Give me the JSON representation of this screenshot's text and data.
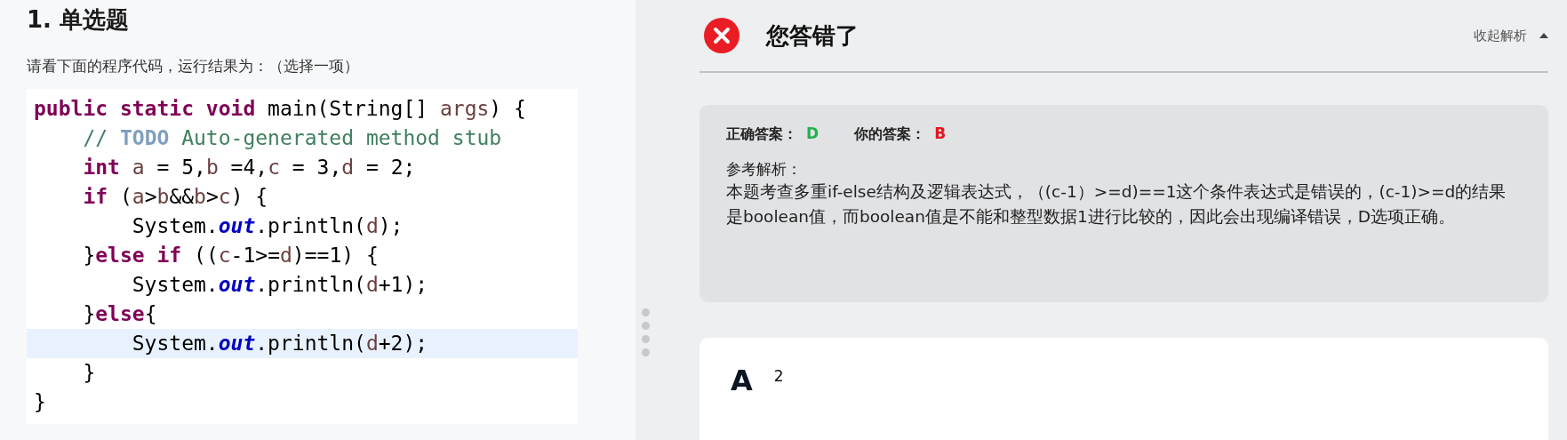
{
  "question": {
    "heading": "1. 单选题",
    "prompt": "请看下面的程序代码，运行结果为：（选择一项）",
    "code": [
      {
        "current": false,
        "tokens": [
          {
            "kind": "keyword",
            "text": "public static void"
          },
          {
            "kind": "plain",
            "text": " main(String[] "
          },
          {
            "kind": "var",
            "text": "args"
          },
          {
            "kind": "plain",
            "text": ") {"
          }
        ]
      },
      {
        "current": false,
        "tokens": [
          {
            "kind": "comment",
            "text": "    // "
          },
          {
            "kind": "todo",
            "text": "TODO"
          },
          {
            "kind": "comment",
            "text": " Auto-generated method stub"
          }
        ]
      },
      {
        "current": false,
        "tokens": [
          {
            "kind": "keyword",
            "text": "    int"
          },
          {
            "kind": "var",
            "text": " a"
          },
          {
            "kind": "plain",
            "text": " = 5,"
          },
          {
            "kind": "var",
            "text": "b"
          },
          {
            "kind": "plain",
            "text": " =4,"
          },
          {
            "kind": "var",
            "text": "c"
          },
          {
            "kind": "plain",
            "text": " = 3,"
          },
          {
            "kind": "var",
            "text": "d"
          },
          {
            "kind": "plain",
            "text": " = 2;"
          }
        ]
      },
      {
        "current": false,
        "tokens": [
          {
            "kind": "keyword",
            "text": "    if"
          },
          {
            "kind": "plain",
            "text": " ("
          },
          {
            "kind": "var",
            "text": "a"
          },
          {
            "kind": "plain",
            "text": ">"
          },
          {
            "kind": "var",
            "text": "b"
          },
          {
            "kind": "plain",
            "text": "&&"
          },
          {
            "kind": "var",
            "text": "b"
          },
          {
            "kind": "plain",
            "text": ">"
          },
          {
            "kind": "var",
            "text": "c"
          },
          {
            "kind": "plain",
            "text": ") {"
          }
        ]
      },
      {
        "current": false,
        "tokens": [
          {
            "kind": "plain",
            "text": "        System."
          },
          {
            "kind": "field",
            "text": "out"
          },
          {
            "kind": "plain",
            "text": ".println("
          },
          {
            "kind": "var",
            "text": "d"
          },
          {
            "kind": "plain",
            "text": ");"
          }
        ]
      },
      {
        "current": false,
        "tokens": [
          {
            "kind": "plain",
            "text": "    }"
          },
          {
            "kind": "keyword",
            "text": "else if"
          },
          {
            "kind": "plain",
            "text": " (("
          },
          {
            "kind": "var",
            "text": "c"
          },
          {
            "kind": "plain",
            "text": "-1>="
          },
          {
            "kind": "var",
            "text": "d"
          },
          {
            "kind": "plain",
            "text": ")==1) {"
          }
        ]
      },
      {
        "current": false,
        "tokens": [
          {
            "kind": "plain",
            "text": "        System."
          },
          {
            "kind": "field",
            "text": "out"
          },
          {
            "kind": "plain",
            "text": ".println("
          },
          {
            "kind": "var",
            "text": "d"
          },
          {
            "kind": "plain",
            "text": "+1);"
          }
        ]
      },
      {
        "current": false,
        "tokens": [
          {
            "kind": "plain",
            "text": "    }"
          },
          {
            "kind": "keyword",
            "text": "else"
          },
          {
            "kind": "plain",
            "text": "{"
          }
        ]
      },
      {
        "current": true,
        "tokens": [
          {
            "kind": "plain",
            "text": "        System."
          },
          {
            "kind": "field",
            "text": "out"
          },
          {
            "kind": "plain",
            "text": ".println("
          },
          {
            "kind": "var",
            "text": "d"
          },
          {
            "kind": "plain",
            "text": "+2);"
          }
        ]
      },
      {
        "current": false,
        "tokens": [
          {
            "kind": "plain",
            "text": "    }"
          }
        ]
      },
      {
        "current": false,
        "tokens": [
          {
            "kind": "plain",
            "text": "}"
          }
        ]
      }
    ]
  },
  "result": {
    "correct": false,
    "title": "您答错了",
    "toggle": {
      "label": "收起解析",
      "expanded": true
    }
  },
  "analysis": {
    "answers": [
      {
        "label": "正确答案：",
        "value": "D",
        "kind": "correct"
      },
      {
        "label": "你的答案：",
        "value": "B",
        "kind": "wrong"
      }
    ],
    "heading": "参考解析：",
    "text": "本题考查多重if-else结构及逻辑表达式，（(c-1）>=d)==1这个条件表达式是错误的，(c-1)>=d的结果是boolean值，而boolean值是不能和整型数据1进行比较的，因此会出现编译错误，D选项正确。"
  },
  "options": [
    {
      "letter": "A",
      "text": "2"
    }
  ]
}
